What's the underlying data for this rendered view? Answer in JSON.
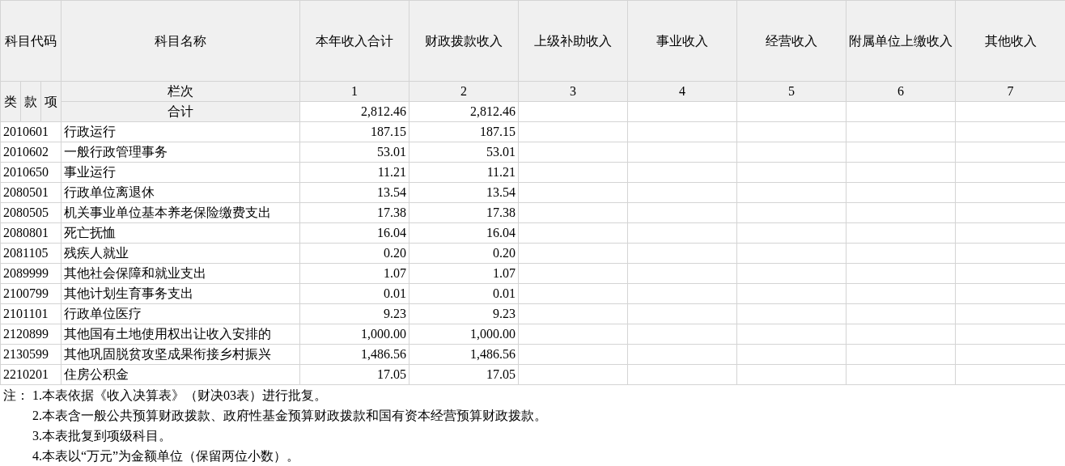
{
  "table": {
    "code_header": "科目代码",
    "columns": [
      "科目名称",
      "本年收入合计",
      "财政拨款收入",
      "上级补助收入",
      "事业收入",
      "经营收入",
      "附属单位上缴收入",
      "其他收入"
    ],
    "code_subcolumns": [
      "类",
      "款",
      "项"
    ],
    "column_numbers_label": "栏次",
    "column_numbers": [
      "1",
      "2",
      "3",
      "4",
      "5",
      "6",
      "7"
    ],
    "total_row": {
      "label": "合计",
      "values": [
        "2,812.46",
        "2,812.46"
      ]
    },
    "rows": [
      {
        "code": "2010601",
        "name": "行政运行",
        "values": [
          "187.15",
          "187.15"
        ]
      },
      {
        "code": "2010602",
        "name": "一般行政管理事务",
        "values": [
          "53.01",
          "53.01"
        ]
      },
      {
        "code": "2010650",
        "name": "事业运行",
        "values": [
          "11.21",
          "11.21"
        ]
      },
      {
        "code": "2080501",
        "name": "行政单位离退休",
        "values": [
          "13.54",
          "13.54"
        ]
      },
      {
        "code": "2080505",
        "name": "机关事业单位基本养老保险缴费支出",
        "values": [
          "17.38",
          "17.38"
        ]
      },
      {
        "code": "2080801",
        "name": "死亡抚恤",
        "values": [
          "16.04",
          "16.04"
        ]
      },
      {
        "code": "2081105",
        "name": "残疾人就业",
        "values": [
          "0.20",
          "0.20"
        ]
      },
      {
        "code": "2089999",
        "name": "其他社会保障和就业支出",
        "values": [
          "1.07",
          "1.07"
        ]
      },
      {
        "code": "2100799",
        "name": "其他计划生育事务支出",
        "values": [
          "0.01",
          "0.01"
        ]
      },
      {
        "code": "2101101",
        "name": "行政单位医疗",
        "values": [
          "9.23",
          "9.23"
        ]
      },
      {
        "code": "2120899",
        "name": "其他国有土地使用权出让收入安排的",
        "values": [
          "1,000.00",
          "1,000.00"
        ]
      },
      {
        "code": "2130599",
        "name": "其他巩固脱贫攻坚成果衔接乡村振兴",
        "values": [
          "1,486.56",
          "1,486.56"
        ]
      },
      {
        "code": "2210201",
        "name": "住房公积金",
        "values": [
          "17.05",
          "17.05"
        ]
      }
    ]
  },
  "notes": {
    "prefix": "注：",
    "items": [
      "1.本表依据《收入决算表》（财决03表）进行批复。",
      "2.本表含一般公共预算财政拨款、政府性基金预算财政拨款和国有资本经营预算财政拨款。",
      "3.本表批复到项级科目。",
      "4.本表以“万元”为金额单位（保留两位小数）。"
    ]
  }
}
